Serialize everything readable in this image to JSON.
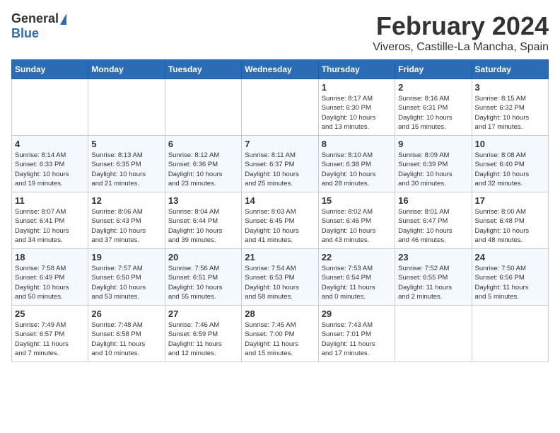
{
  "header": {
    "logo_general": "General",
    "logo_blue": "Blue",
    "month": "February 2024",
    "location": "Viveros, Castille-La Mancha, Spain"
  },
  "weekdays": [
    "Sunday",
    "Monday",
    "Tuesday",
    "Wednesday",
    "Thursday",
    "Friday",
    "Saturday"
  ],
  "weeks": [
    [
      {
        "day": "",
        "info": ""
      },
      {
        "day": "",
        "info": ""
      },
      {
        "day": "",
        "info": ""
      },
      {
        "day": "",
        "info": ""
      },
      {
        "day": "1",
        "info": "Sunrise: 8:17 AM\nSunset: 6:30 PM\nDaylight: 10 hours\nand 13 minutes."
      },
      {
        "day": "2",
        "info": "Sunrise: 8:16 AM\nSunset: 6:31 PM\nDaylight: 10 hours\nand 15 minutes."
      },
      {
        "day": "3",
        "info": "Sunrise: 8:15 AM\nSunset: 6:32 PM\nDaylight: 10 hours\nand 17 minutes."
      }
    ],
    [
      {
        "day": "4",
        "info": "Sunrise: 8:14 AM\nSunset: 6:33 PM\nDaylight: 10 hours\nand 19 minutes."
      },
      {
        "day": "5",
        "info": "Sunrise: 8:13 AM\nSunset: 6:35 PM\nDaylight: 10 hours\nand 21 minutes."
      },
      {
        "day": "6",
        "info": "Sunrise: 8:12 AM\nSunset: 6:36 PM\nDaylight: 10 hours\nand 23 minutes."
      },
      {
        "day": "7",
        "info": "Sunrise: 8:11 AM\nSunset: 6:37 PM\nDaylight: 10 hours\nand 25 minutes."
      },
      {
        "day": "8",
        "info": "Sunrise: 8:10 AM\nSunset: 6:38 PM\nDaylight: 10 hours\nand 28 minutes."
      },
      {
        "day": "9",
        "info": "Sunrise: 8:09 AM\nSunset: 6:39 PM\nDaylight: 10 hours\nand 30 minutes."
      },
      {
        "day": "10",
        "info": "Sunrise: 8:08 AM\nSunset: 6:40 PM\nDaylight: 10 hours\nand 32 minutes."
      }
    ],
    [
      {
        "day": "11",
        "info": "Sunrise: 8:07 AM\nSunset: 6:41 PM\nDaylight: 10 hours\nand 34 minutes."
      },
      {
        "day": "12",
        "info": "Sunrise: 8:06 AM\nSunset: 6:43 PM\nDaylight: 10 hours\nand 37 minutes."
      },
      {
        "day": "13",
        "info": "Sunrise: 8:04 AM\nSunset: 6:44 PM\nDaylight: 10 hours\nand 39 minutes."
      },
      {
        "day": "14",
        "info": "Sunrise: 8:03 AM\nSunset: 6:45 PM\nDaylight: 10 hours\nand 41 minutes."
      },
      {
        "day": "15",
        "info": "Sunrise: 8:02 AM\nSunset: 6:46 PM\nDaylight: 10 hours\nand 43 minutes."
      },
      {
        "day": "16",
        "info": "Sunrise: 8:01 AM\nSunset: 6:47 PM\nDaylight: 10 hours\nand 46 minutes."
      },
      {
        "day": "17",
        "info": "Sunrise: 8:00 AM\nSunset: 6:48 PM\nDaylight: 10 hours\nand 48 minutes."
      }
    ],
    [
      {
        "day": "18",
        "info": "Sunrise: 7:58 AM\nSunset: 6:49 PM\nDaylight: 10 hours\nand 50 minutes."
      },
      {
        "day": "19",
        "info": "Sunrise: 7:57 AM\nSunset: 6:50 PM\nDaylight: 10 hours\nand 53 minutes."
      },
      {
        "day": "20",
        "info": "Sunrise: 7:56 AM\nSunset: 6:51 PM\nDaylight: 10 hours\nand 55 minutes."
      },
      {
        "day": "21",
        "info": "Sunrise: 7:54 AM\nSunset: 6:53 PM\nDaylight: 10 hours\nand 58 minutes."
      },
      {
        "day": "22",
        "info": "Sunrise: 7:53 AM\nSunset: 6:54 PM\nDaylight: 11 hours\nand 0 minutes."
      },
      {
        "day": "23",
        "info": "Sunrise: 7:52 AM\nSunset: 6:55 PM\nDaylight: 11 hours\nand 2 minutes."
      },
      {
        "day": "24",
        "info": "Sunrise: 7:50 AM\nSunset: 6:56 PM\nDaylight: 11 hours\nand 5 minutes."
      }
    ],
    [
      {
        "day": "25",
        "info": "Sunrise: 7:49 AM\nSunset: 6:57 PM\nDaylight: 11 hours\nand 7 minutes."
      },
      {
        "day": "26",
        "info": "Sunrise: 7:48 AM\nSunset: 6:58 PM\nDaylight: 11 hours\nand 10 minutes."
      },
      {
        "day": "27",
        "info": "Sunrise: 7:46 AM\nSunset: 6:59 PM\nDaylight: 11 hours\nand 12 minutes."
      },
      {
        "day": "28",
        "info": "Sunrise: 7:45 AM\nSunset: 7:00 PM\nDaylight: 11 hours\nand 15 minutes."
      },
      {
        "day": "29",
        "info": "Sunrise: 7:43 AM\nSunset: 7:01 PM\nDaylight: 11 hours\nand 17 minutes."
      },
      {
        "day": "",
        "info": ""
      },
      {
        "day": "",
        "info": ""
      }
    ]
  ]
}
